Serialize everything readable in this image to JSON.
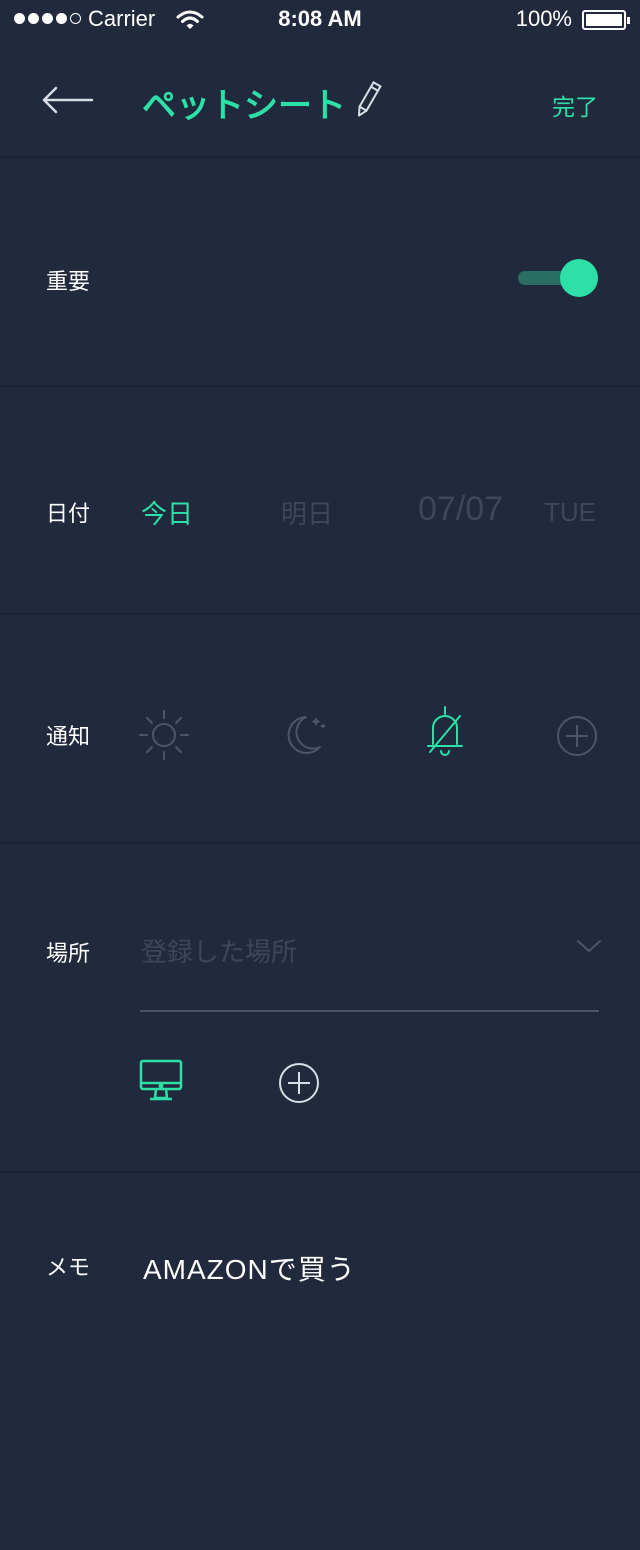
{
  "status_bar": {
    "carrier": "Carrier",
    "time": "8:08 AM",
    "battery": "100%",
    "signal_bars_filled": 4,
    "signal_bars_total": 5
  },
  "nav": {
    "back_icon": "arrow-left-icon",
    "title": "ペットシート",
    "edit_icon": "pencil-icon",
    "done_label": "完了"
  },
  "important": {
    "label": "重要",
    "toggle_on": true
  },
  "date": {
    "label": "日付",
    "today": "今日",
    "tomorrow": "明日",
    "date_value": "07/07",
    "day_of_week": "TUE",
    "selected": "today"
  },
  "notification": {
    "label": "通知",
    "options": [
      "sun-icon",
      "moon-icon",
      "bell-off-icon",
      "plus-circle-icon"
    ],
    "selected": "bell-off-icon"
  },
  "location": {
    "label": "場所",
    "placeholder": "登録した場所",
    "devices": [
      "desktop-icon",
      "plus-circle-icon"
    ],
    "selected": "desktop-icon"
  },
  "memo": {
    "label": "メモ",
    "value": "AMAZONで買う"
  },
  "colors": {
    "background": "#212a3c",
    "accent": "#2de0a7",
    "muted": "#3d4759",
    "icon_muted": "#4c5669"
  }
}
